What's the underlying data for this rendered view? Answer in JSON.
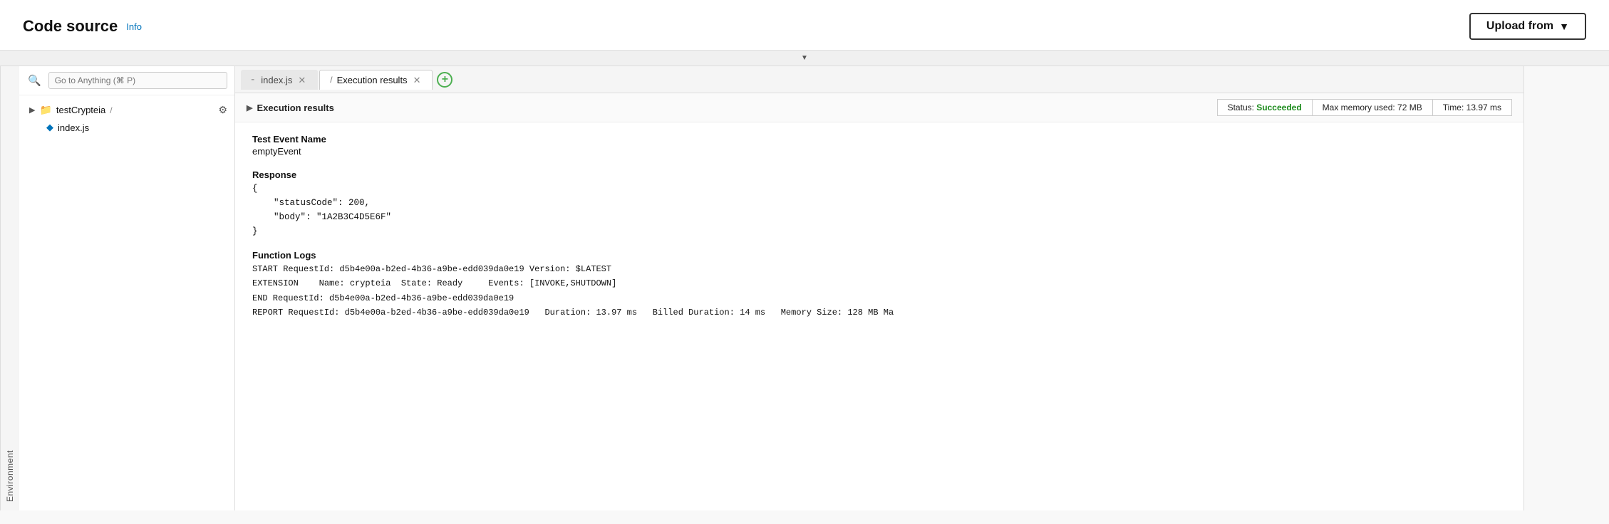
{
  "header": {
    "title": "Code source",
    "info_label": "Info",
    "upload_button": "Upload from",
    "upload_chevron": "▼"
  },
  "collapse_bar": {
    "icon": "▼"
  },
  "sidebar": {
    "env_label": "Environment",
    "search_placeholder": "Go to Anything (⌘ P)",
    "folder": {
      "name": "testCrypteia",
      "path": "/"
    },
    "files": [
      {
        "name": "index.js",
        "icon": "◈"
      }
    ]
  },
  "tabs": [
    {
      "id": "index-js",
      "label": "index.js",
      "icon": "≡",
      "closable": true,
      "active": false
    },
    {
      "id": "execution-results",
      "label": "Execution results",
      "icon": "/",
      "closable": true,
      "active": true
    }
  ],
  "tab_add_label": "+",
  "execution_panel": {
    "title": "Execution results",
    "chevron": "▼",
    "status_label": "Status:",
    "status_value": "Succeeded",
    "memory_label": "Max memory used:",
    "memory_value": "72 MB",
    "time_label": "Time:",
    "time_value": "13.97 ms",
    "test_event_label": "Test Event Name",
    "test_event_value": "emptyEvent",
    "response_label": "Response",
    "response_code": "{\n    \"statusCode\": 200,\n    \"body\": \"1A2B3C4D5E6F\"\n}",
    "function_logs_label": "Function Logs",
    "function_logs": "START RequestId: d5b4e00a-b2ed-4b36-a9be-edd039da0e19 Version: $LATEST\nEXTENSION    Name: crypteia  State: Ready     Events: [INVOKE,SHUTDOWN]\nEND RequestId: d5b4e00a-b2ed-4b36-a9be-edd039da0e19\nREPORT RequestId: d5b4e00a-b2ed-4b36-a9be-edd039da0e19   Duration: 13.97 ms   Billed Duration: 14 ms   Memory Size: 128 MB Ma"
  }
}
